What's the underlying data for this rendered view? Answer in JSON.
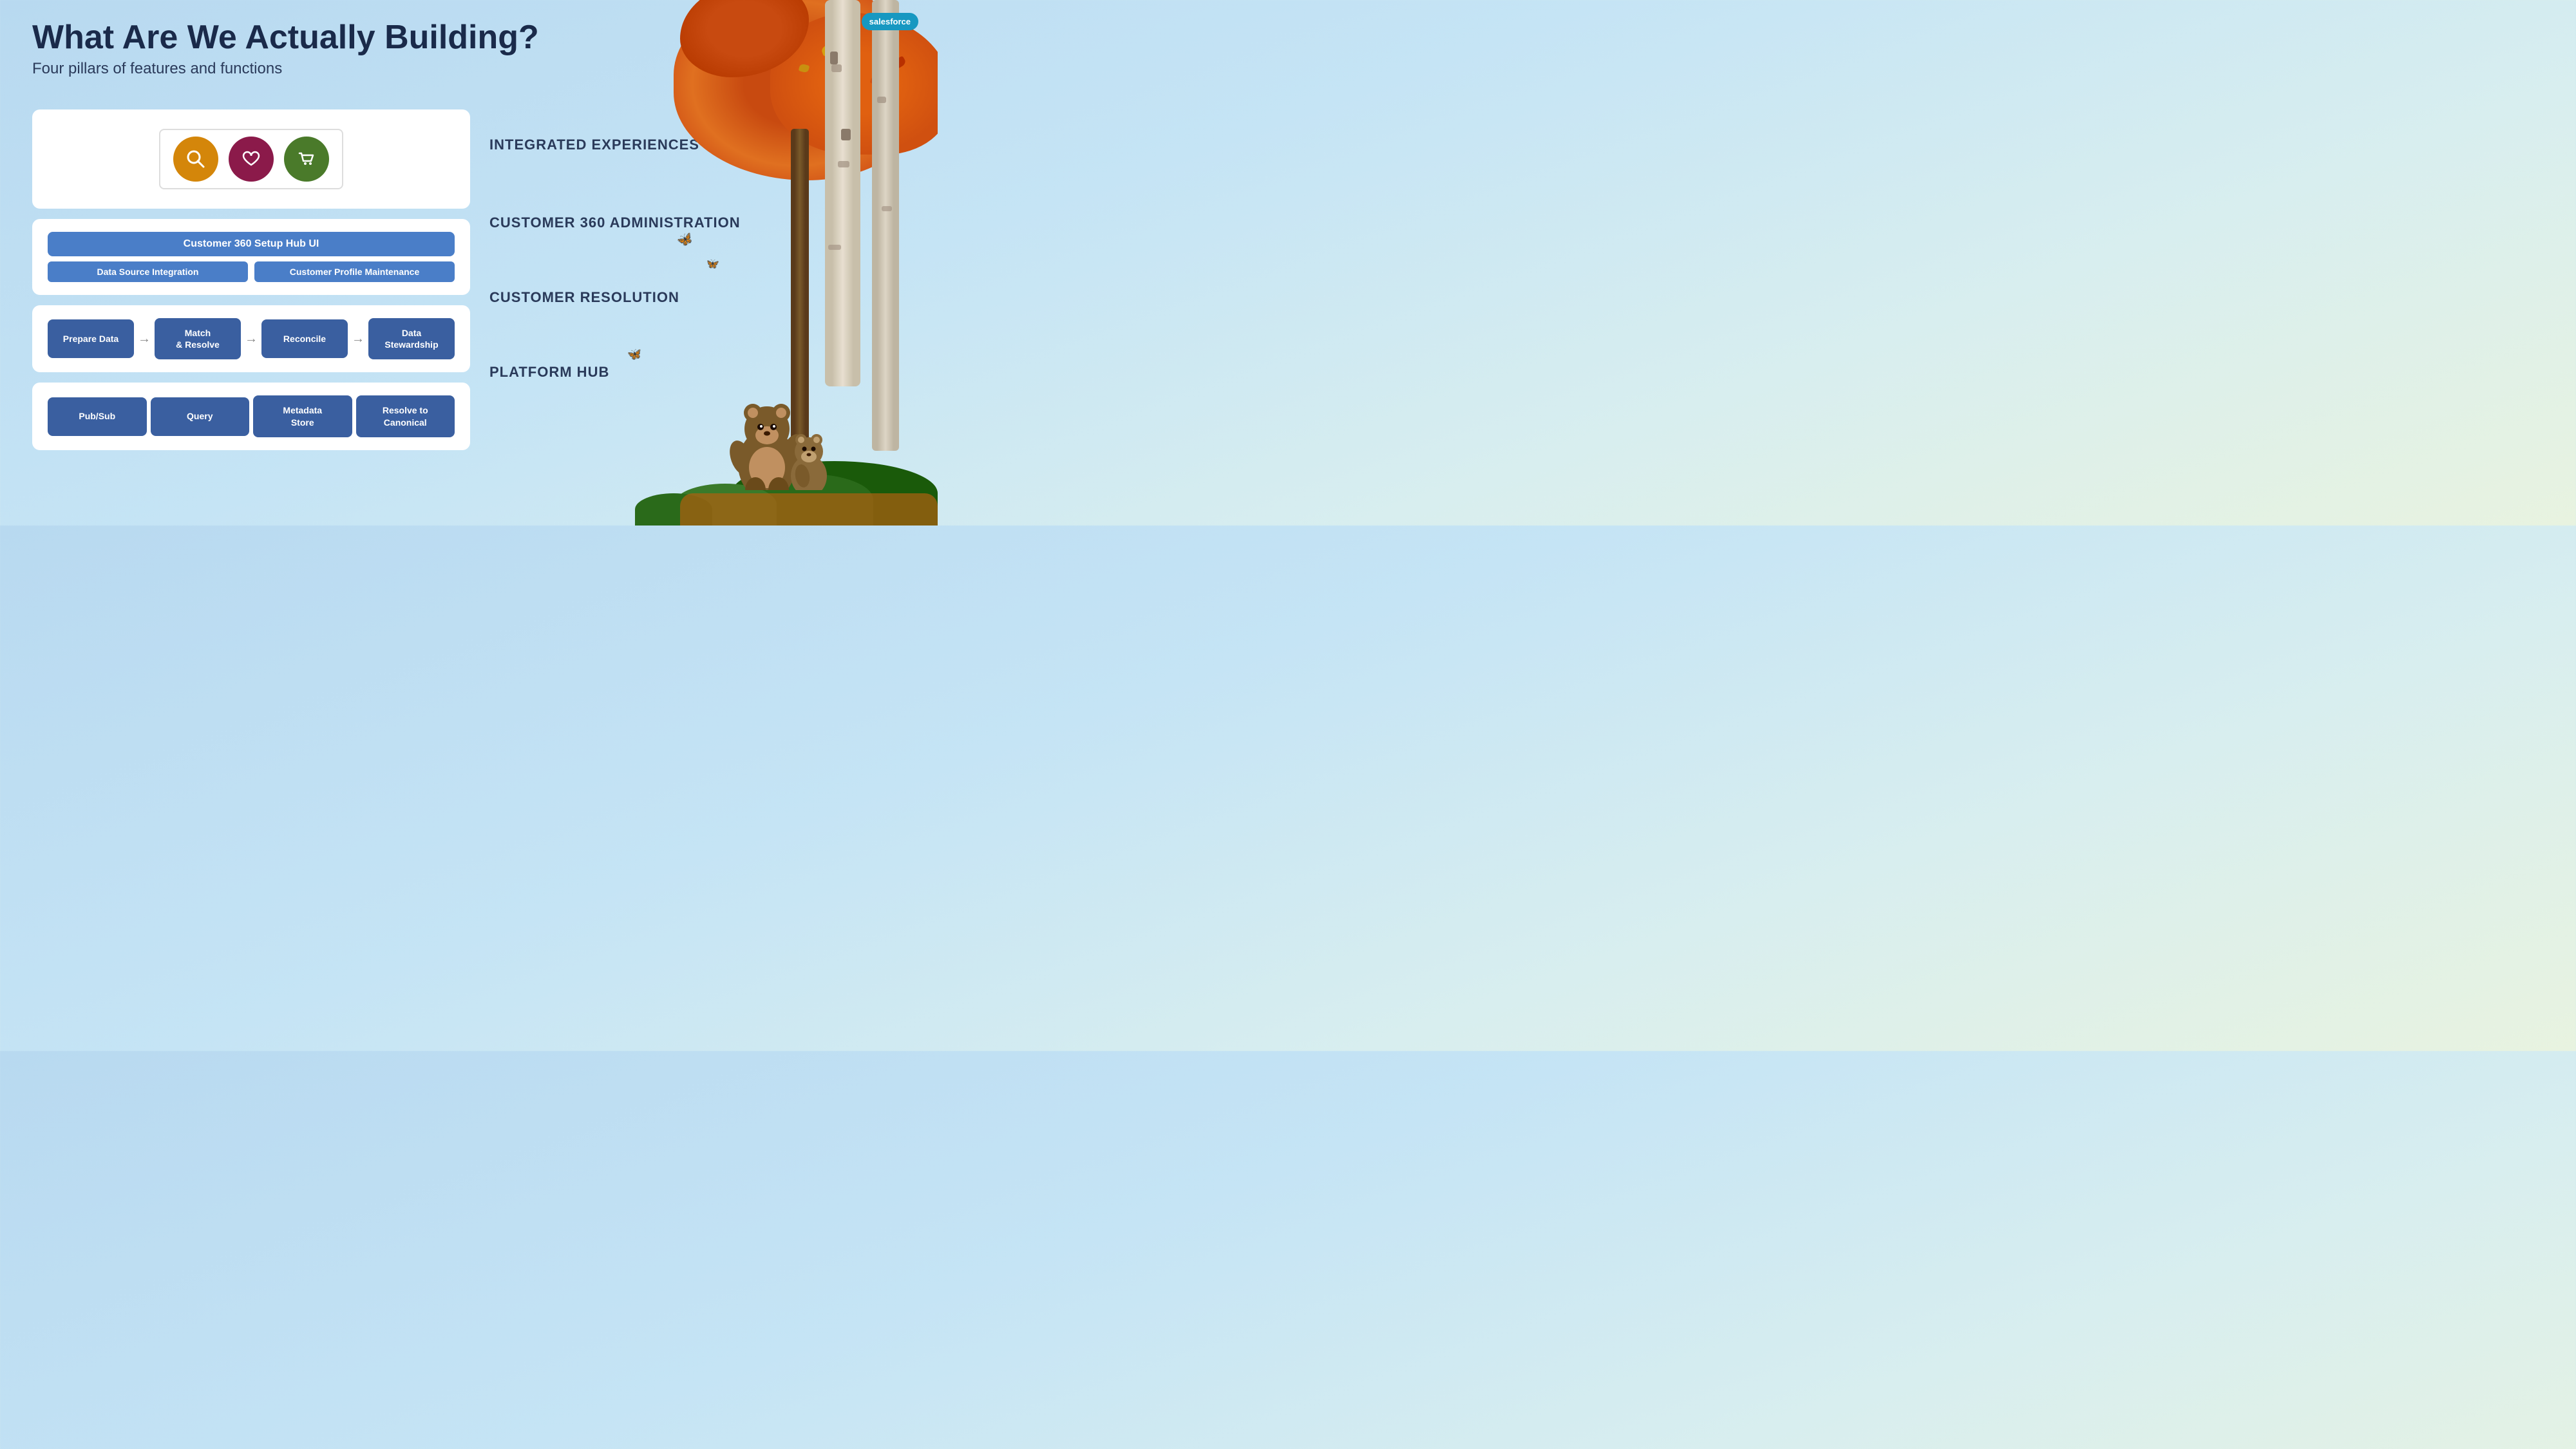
{
  "app": {
    "logo": "salesforce"
  },
  "header": {
    "title": "What Are We Actually Building?",
    "subtitle": "Four pillars of features and functions"
  },
  "pillars": [
    {
      "id": "p1",
      "label": "INTEGRATED EXPERIENCES",
      "card_type": "icons",
      "icons": [
        {
          "name": "search",
          "color": "orange",
          "symbol": "🔍"
        },
        {
          "name": "heart",
          "color": "maroon",
          "symbol": "♡"
        },
        {
          "name": "cart",
          "color": "green",
          "symbol": "🛒"
        }
      ]
    },
    {
      "id": "p2",
      "label": "CUSTOMER 360 ADMINISTRATION",
      "card_type": "admin",
      "top_bar": "Customer 360 Setup Hub UI",
      "chips": [
        "Data Source Integration",
        "Customer Profile Maintenance"
      ]
    },
    {
      "id": "p3",
      "label": "CUSTOMER RESOLUTION",
      "card_type": "flow",
      "steps": [
        "Prepare Data",
        "Match\n& Resolve",
        "Reconcile",
        "Data\nStewardship"
      ]
    },
    {
      "id": "p4",
      "label": "PLATFORM HUB",
      "card_type": "flow",
      "steps": [
        "Pub/Sub",
        "Query",
        "Metadata\nStore",
        "Resolve to\nCanonical"
      ]
    }
  ]
}
